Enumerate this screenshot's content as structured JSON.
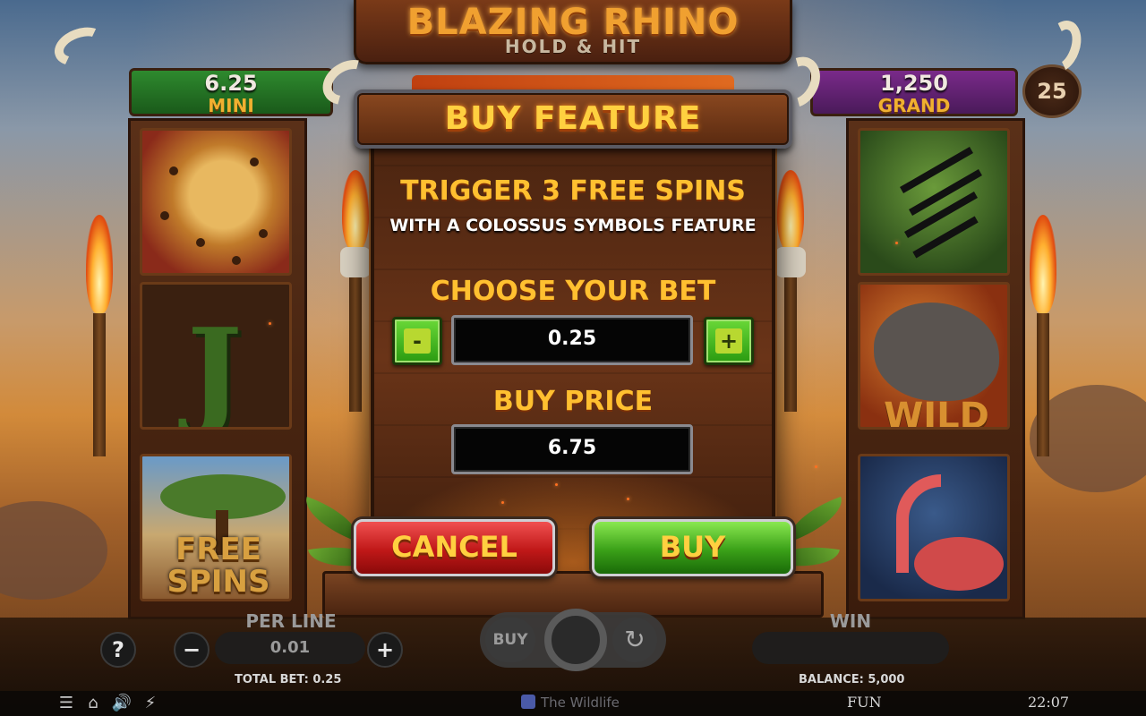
{
  "game": {
    "title": "BLAZING RHINO",
    "subtitle": "HOLD & HIT"
  },
  "jackpots": {
    "mini": {
      "value": "6.25",
      "label": "MINI"
    },
    "grand": {
      "value": "1,250",
      "label": "GRAND"
    }
  },
  "lines_badge": "25",
  "reels": {
    "free_spins_symbol": "FREE SPINS",
    "wild_symbol": "WILD",
    "letter_symbol": "J"
  },
  "dialog": {
    "title": "BUY FEATURE",
    "trigger_text": "TRIGGER 3 FREE SPINS",
    "feature_text": "WITH A COLOSSUS SYMBOLS FEATURE",
    "choose_label": "CHOOSE YOUR BET",
    "minus_label": "-",
    "plus_label": "+",
    "bet_value": "0.25",
    "buy_price_label": "BUY PRICE",
    "buy_price_value": "6.75",
    "cancel_label": "CANCEL",
    "buy_label": "BUY"
  },
  "controls": {
    "help_label": "?",
    "minus_label": "−",
    "plus_label": "+",
    "per_line_label": "PER LINE",
    "per_line_value": "0.01",
    "buy_small_label": "BUY",
    "win_label": "WIN",
    "total_bet": "TOTAL BET: 0.25",
    "balance": "BALANCE: 5,000"
  },
  "status_bar": {
    "brand": "The Wildlife",
    "mode": "FUN",
    "time": "22:07",
    "icons": [
      "menu-icon",
      "home-icon",
      "sound-icon",
      "turbo-icon"
    ]
  },
  "colors": {
    "gold_text": "#ffc030",
    "cancel_red": "#c01818",
    "buy_green": "#3aa018",
    "mini_green": "#2e8a2e",
    "grand_purple": "#7a2a8a"
  }
}
